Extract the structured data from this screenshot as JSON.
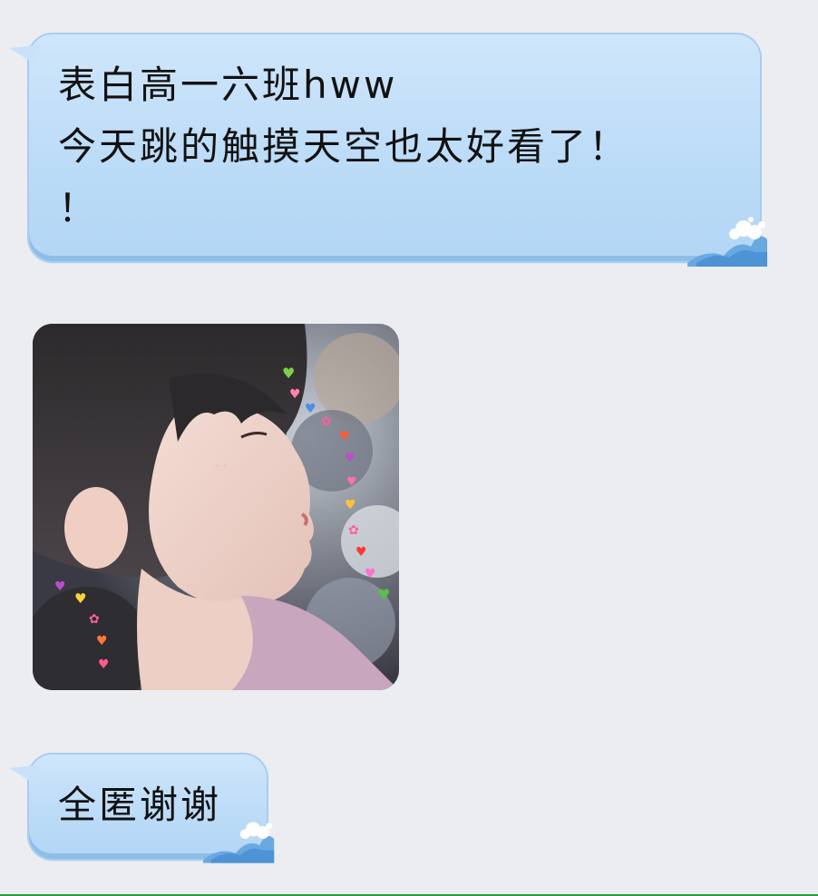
{
  "messages": [
    {
      "type": "text",
      "lines": [
        "表白高一六班hww",
        "今天跳的触摸天空也太好看了！",
        "！"
      ]
    },
    {
      "type": "image",
      "icon": "photo-of-girl-with-heart-stickers"
    },
    {
      "type": "text",
      "lines": [
        "全匿谢谢"
      ]
    }
  ],
  "colors": {
    "bubble_top": "#cfe6fb",
    "bubble_bottom": "#b3d6f5",
    "bubble_border": "#a9cdef",
    "chat_background": "#ebedf0",
    "bottom_line": "#2a9a3a"
  }
}
